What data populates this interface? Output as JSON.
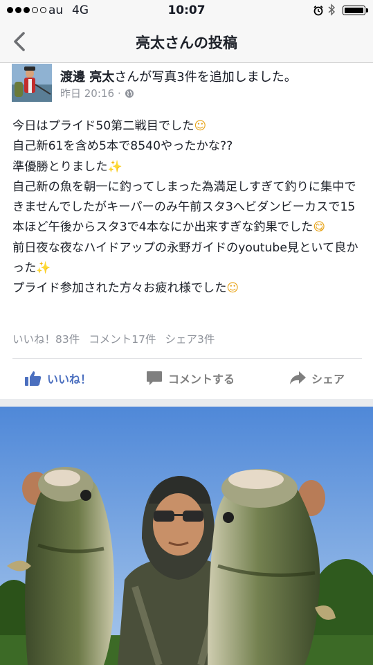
{
  "status_bar": {
    "carrier": "au",
    "network": "4G",
    "time": "10:07"
  },
  "nav": {
    "title": "亮太さんの投稿"
  },
  "post": {
    "author": "渡邊 亮太",
    "action_text": "さんが写真3件を追加しました。",
    "time": "昨日 20:16",
    "separator": "·",
    "lines": [
      {
        "text": "今日はプライド50第二戦目でした",
        "emoji": "☺"
      },
      {
        "text": "自己新61を含め5本で8540やったかな??",
        "emoji": ""
      },
      {
        "text": "準優勝とりました",
        "emoji": "✨"
      },
      {
        "text": "自己新の魚を朝一に釣ってしまった為満足しすぎて釣りに集中できませんでしたがキーパーのみ午前スタ3へビダンビーカスで15本ほど午後からスタ3で4本なにか出来すぎな釣果でした",
        "emoji": "😋"
      },
      {
        "text": "前日夜な夜なハイドアップの永野ガイドのyoutube見といて良かった",
        "emoji": "✨"
      },
      {
        "text": "プライド参加された方々お疲れ様でした",
        "emoji": "☺"
      }
    ],
    "counts": {
      "likes": "いいね！83件",
      "comments": "コメント17件",
      "shares": "シェア3件"
    },
    "actions": {
      "like": "いいね！",
      "comment": "コメントする",
      "share": "シェア"
    }
  },
  "colors": {
    "link_blue": "#4b6fbf",
    "muted": "#90949c",
    "text": "#1d2129"
  }
}
